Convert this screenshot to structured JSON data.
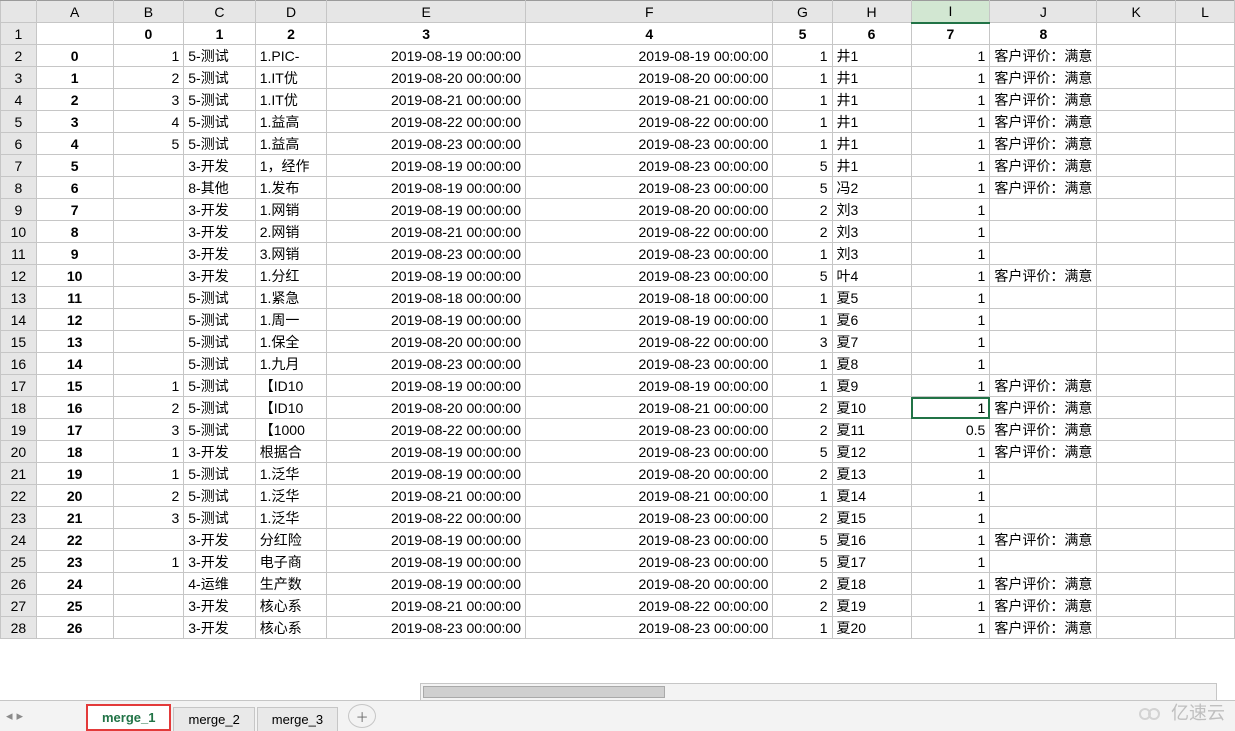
{
  "col_letters": [
    "",
    "A",
    "B",
    "C",
    "D",
    "E",
    "F",
    "G",
    "H",
    "I",
    "J",
    "K",
    "L"
  ],
  "selected_column_index": 9,
  "active_cell": {
    "row": 18,
    "col": 9
  },
  "data_header": [
    "",
    "0",
    "1",
    "2",
    "3",
    "4",
    "5",
    "6",
    "7",
    "8"
  ],
  "rows": [
    {
      "n": "2",
      "idx": "0",
      "b": "1",
      "c": "5-测试",
      "d": "1.PIC-",
      "e": "2019-08-19 00:00:00",
      "f": "2019-08-19 00:00:00",
      "g": "1",
      "h": "井1",
      "i": "1",
      "j": "客户评价：满意"
    },
    {
      "n": "3",
      "idx": "1",
      "b": "2",
      "c": "5-测试",
      "d": "1.IT优",
      "e": "2019-08-20 00:00:00",
      "f": "2019-08-20 00:00:00",
      "g": "1",
      "h": "井1",
      "i": "1",
      "j": "客户评价：满意"
    },
    {
      "n": "4",
      "idx": "2",
      "b": "3",
      "c": "5-测试",
      "d": "1.IT优",
      "e": "2019-08-21 00:00:00",
      "f": "2019-08-21 00:00:00",
      "g": "1",
      "h": "井1",
      "i": "1",
      "j": "客户评价：满意"
    },
    {
      "n": "5",
      "idx": "3",
      "b": "4",
      "c": "5-测试",
      "d": "1.益高",
      "e": "2019-08-22 00:00:00",
      "f": "2019-08-22 00:00:00",
      "g": "1",
      "h": "井1",
      "i": "1",
      "j": "客户评价：满意"
    },
    {
      "n": "6",
      "idx": "4",
      "b": "5",
      "c": "5-测试",
      "d": "1.益高",
      "e": "2019-08-23 00:00:00",
      "f": "2019-08-23 00:00:00",
      "g": "1",
      "h": "井1",
      "i": "1",
      "j": "客户评价：满意"
    },
    {
      "n": "7",
      "idx": "5",
      "b": "",
      "c": "3-开发",
      "d": "1，经作",
      "e": "2019-08-19 00:00:00",
      "f": "2019-08-23 00:00:00",
      "g": "5",
      "h": "井1",
      "i": "1",
      "j": "客户评价：满意"
    },
    {
      "n": "8",
      "idx": "6",
      "b": "",
      "c": "8-其他",
      "d": "1.发布",
      "e": "2019-08-19 00:00:00",
      "f": "2019-08-23 00:00:00",
      "g": "5",
      "h": "冯2",
      "i": "1",
      "j": "客户评价：满意"
    },
    {
      "n": "9",
      "idx": "7",
      "b": "",
      "c": "3-开发",
      "d": "1.网销",
      "e": "2019-08-19 00:00:00",
      "f": "2019-08-20 00:00:00",
      "g": "2",
      "h": "刘3",
      "i": "1",
      "j": ""
    },
    {
      "n": "10",
      "idx": "8",
      "b": "",
      "c": "3-开发",
      "d": "2.网销",
      "e": "2019-08-21 00:00:00",
      "f": "2019-08-22 00:00:00",
      "g": "2",
      "h": "刘3",
      "i": "1",
      "j": ""
    },
    {
      "n": "11",
      "idx": "9",
      "b": "",
      "c": "3-开发",
      "d": "3.网销",
      "e": "2019-08-23 00:00:00",
      "f": "2019-08-23 00:00:00",
      "g": "1",
      "h": "刘3",
      "i": "1",
      "j": ""
    },
    {
      "n": "12",
      "idx": "10",
      "b": "",
      "c": "3-开发",
      "d": "1.分红",
      "e": "2019-08-19 00:00:00",
      "f": "2019-08-23 00:00:00",
      "g": "5",
      "h": "叶4",
      "i": "1",
      "j": "客户评价：满意"
    },
    {
      "n": "13",
      "idx": "11",
      "b": "",
      "c": "5-测试",
      "d": "1.紧急",
      "e": "2019-08-18 00:00:00",
      "f": "2019-08-18 00:00:00",
      "g": "1",
      "h": "夏5",
      "i": "1",
      "j": ""
    },
    {
      "n": "14",
      "idx": "12",
      "b": "",
      "c": "5-测试",
      "d": "1.周一",
      "e": "2019-08-19 00:00:00",
      "f": "2019-08-19 00:00:00",
      "g": "1",
      "h": "夏6",
      "i": "1",
      "j": ""
    },
    {
      "n": "15",
      "idx": "13",
      "b": "",
      "c": "5-测试",
      "d": "1.保全",
      "e": "2019-08-20 00:00:00",
      "f": "2019-08-22 00:00:00",
      "g": "3",
      "h": "夏7",
      "i": "1",
      "j": ""
    },
    {
      "n": "16",
      "idx": "14",
      "b": "",
      "c": "5-测试",
      "d": "1.九月",
      "e": "2019-08-23 00:00:00",
      "f": "2019-08-23 00:00:00",
      "g": "1",
      "h": "夏8",
      "i": "1",
      "j": ""
    },
    {
      "n": "17",
      "idx": "15",
      "b": "1",
      "c": "5-测试",
      "d": "【ID10",
      "e": "2019-08-19 00:00:00",
      "f": "2019-08-19 00:00:00",
      "g": "1",
      "h": "夏9",
      "i": "1",
      "j": "客户评价：满意"
    },
    {
      "n": "18",
      "idx": "16",
      "b": "2",
      "c": "5-测试",
      "d": "【ID10",
      "e": "2019-08-20 00:00:00",
      "f": "2019-08-21 00:00:00",
      "g": "2",
      "h": "夏10",
      "i": "1",
      "j": "客户评价：满意"
    },
    {
      "n": "19",
      "idx": "17",
      "b": "3",
      "c": "5-测试",
      "d": "【1000",
      "e": "2019-08-22 00:00:00",
      "f": "2019-08-23 00:00:00",
      "g": "2",
      "h": "夏11",
      "i": "0.5",
      "j": "客户评价：满意"
    },
    {
      "n": "20",
      "idx": "18",
      "b": "1",
      "c": "3-开发",
      "d": "根据合",
      "e": "2019-08-19 00:00:00",
      "f": "2019-08-23 00:00:00",
      "g": "5",
      "h": "夏12",
      "i": "1",
      "j": "客户评价：满意"
    },
    {
      "n": "21",
      "idx": "19",
      "b": "1",
      "c": "5-测试",
      "d": "1.泛华",
      "e": "2019-08-19 00:00:00",
      "f": "2019-08-20 00:00:00",
      "g": "2",
      "h": "夏13",
      "i": "1",
      "j": ""
    },
    {
      "n": "22",
      "idx": "20",
      "b": "2",
      "c": "5-测试",
      "d": "1.泛华",
      "e": "2019-08-21 00:00:00",
      "f": "2019-08-21 00:00:00",
      "g": "1",
      "h": "夏14",
      "i": "1",
      "j": ""
    },
    {
      "n": "23",
      "idx": "21",
      "b": "3",
      "c": "5-测试",
      "d": "1.泛华",
      "e": "2019-08-22 00:00:00",
      "f": "2019-08-23 00:00:00",
      "g": "2",
      "h": "夏15",
      "i": "1",
      "j": ""
    },
    {
      "n": "24",
      "idx": "22",
      "b": "",
      "c": "3-开发",
      "d": "分红险",
      "e": "2019-08-19 00:00:00",
      "f": "2019-08-23 00:00:00",
      "g": "5",
      "h": "夏16",
      "i": "1",
      "j": "客户评价：满意"
    },
    {
      "n": "25",
      "idx": "23",
      "b": "1",
      "c": "3-开发",
      "d": "电子商",
      "e": "2019-08-19 00:00:00",
      "f": "2019-08-23 00:00:00",
      "g": "5",
      "h": "夏17",
      "i": "1",
      "j": ""
    },
    {
      "n": "26",
      "idx": "24",
      "b": "",
      "c": "4-运维",
      "d": "生产数",
      "e": "2019-08-19 00:00:00",
      "f": "2019-08-20 00:00:00",
      "g": "2",
      "h": "夏18",
      "i": "1",
      "j": "客户评价：满意"
    },
    {
      "n": "27",
      "idx": "25",
      "b": "",
      "c": "3-开发",
      "d": "核心系",
      "e": "2019-08-21 00:00:00",
      "f": "2019-08-22 00:00:00",
      "g": "2",
      "h": "夏19",
      "i": "1",
      "j": "客户评价：满意"
    },
    {
      "n": "28",
      "idx": "26",
      "b": "",
      "c": "3-开发",
      "d": "核心系",
      "e": "2019-08-23 00:00:00",
      "f": "2019-08-23 00:00:00",
      "g": "1",
      "h": "夏20",
      "i": "1",
      "j": "客户评价：满意"
    }
  ],
  "tabs": [
    "merge_1",
    "merge_2",
    "merge_3"
  ],
  "active_tab": 0,
  "watermark": "亿速云"
}
